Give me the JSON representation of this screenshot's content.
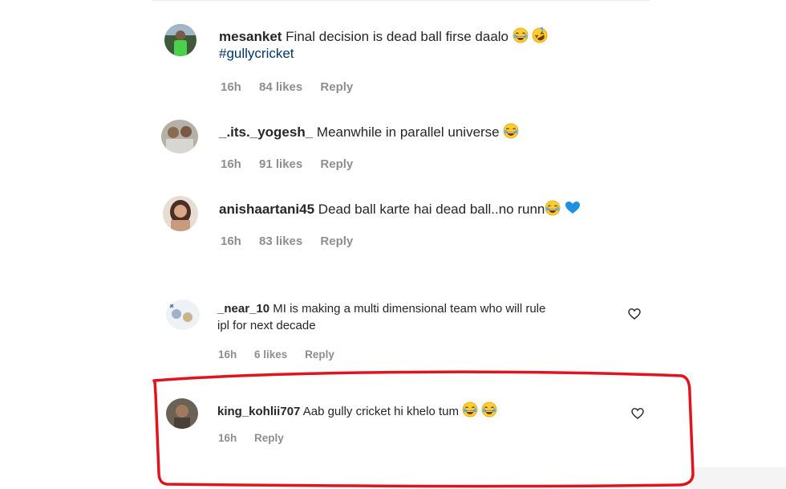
{
  "comments": [
    {
      "username": "mesanket",
      "text": "Final decision is dead ball firse daalo",
      "emojis": [
        "laugh",
        "rofl"
      ],
      "hashtag": "#gullycricket",
      "time": "16h",
      "likes": "84 likes",
      "reply": "Reply"
    },
    {
      "username": "_.its._yogesh_",
      "text": "Meanwhile in parallel universe",
      "emojis": [
        "laugh"
      ],
      "time": "16h",
      "likes": "91 likes",
      "reply": "Reply"
    },
    {
      "username": "anishaartani45",
      "text": "Dead ball karte hai dead ball..no runn",
      "emojis": [
        "laugh",
        "blue-heart"
      ],
      "time": "16h",
      "likes": "83 likes",
      "reply": "Reply"
    },
    {
      "username": "_near_10",
      "text_line1": "MI is making a multi dimensional team who will rule",
      "text_line2": "ipl for next decade",
      "time": "16h",
      "likes": "6 likes",
      "reply": "Reply"
    },
    {
      "username": "king_kohlii707",
      "text": "Aab gully cricket hi khelo tum",
      "emojis": [
        "laugh",
        "laugh"
      ],
      "time": "16h",
      "reply": "Reply"
    }
  ],
  "icons": {
    "like": "heart-outline-icon",
    "laugh": "face-with-tears-of-joy",
    "rofl": "rolling-on-floor-laughing",
    "blue_heart": "blue-heart"
  },
  "colors": {
    "meta_text": "#8e8e8e",
    "hashtag": "#00376b",
    "highlight": "#e0141e",
    "blue_heart": "#1f8fe0"
  }
}
